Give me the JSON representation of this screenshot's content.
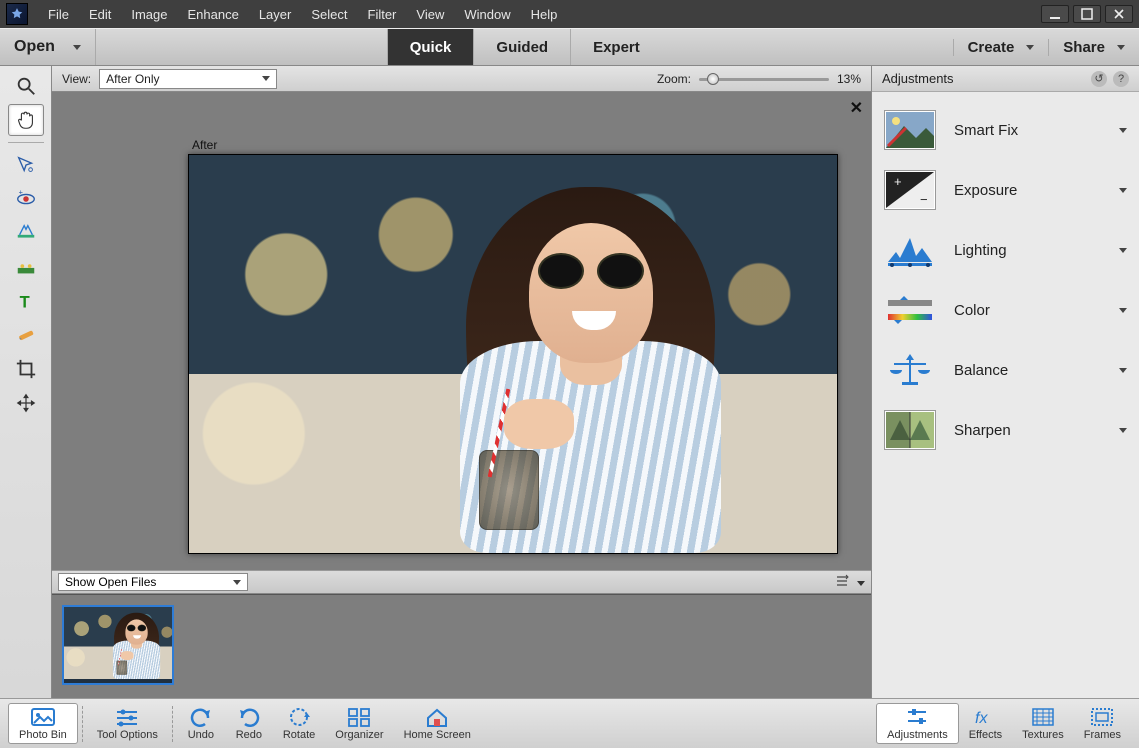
{
  "menu": {
    "items": [
      "File",
      "Edit",
      "Image",
      "Enhance",
      "Layer",
      "Select",
      "Filter",
      "View",
      "Window",
      "Help"
    ]
  },
  "modebar": {
    "open": "Open",
    "tabs": [
      "Quick",
      "Guided",
      "Expert"
    ],
    "active": "Quick",
    "create": "Create",
    "share": "Share"
  },
  "viewbar": {
    "view_label": "View:",
    "view_value": "After Only",
    "zoom_label": "Zoom:",
    "zoom_value": "13%",
    "after_label": "After"
  },
  "binbar": {
    "dropdown": "Show Open Files"
  },
  "rightpanel": {
    "title": "Adjustments",
    "items": [
      "Smart Fix",
      "Exposure",
      "Lighting",
      "Color",
      "Balance",
      "Sharpen"
    ]
  },
  "bottombar": {
    "left": [
      "Photo Bin",
      "Tool Options",
      "Undo",
      "Redo",
      "Rotate",
      "Organizer",
      "Home Screen"
    ],
    "right": [
      "Adjustments",
      "Effects",
      "Textures",
      "Frames"
    ]
  },
  "tools": [
    "zoom",
    "hand",
    "wand",
    "eye",
    "brush",
    "stamp",
    "text",
    "ruler",
    "crop",
    "move"
  ]
}
